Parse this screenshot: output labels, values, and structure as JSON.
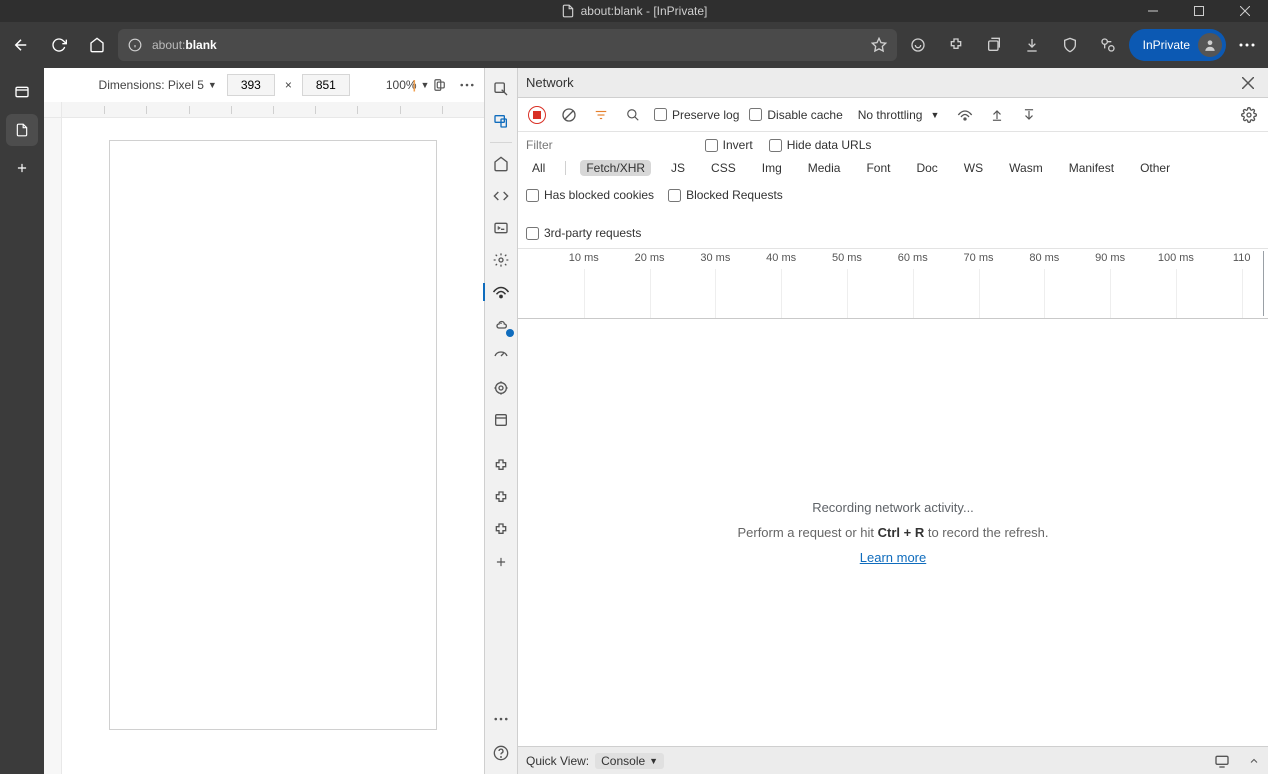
{
  "titlebar": {
    "title": "about:blank - [InPrivate]"
  },
  "toolbar": {
    "url_protocol": "about:",
    "url_rest": "blank",
    "inprivate_label": "InPrivate"
  },
  "device_bar": {
    "dimensions_label": "Dimensions: Pixel 5",
    "width": "393",
    "height": "851",
    "x_label": "×",
    "zoom": "100%"
  },
  "devtools": {
    "panel_title": "Network",
    "preserve_log": "Preserve log",
    "disable_cache": "Disable cache",
    "throttling": "No throttling",
    "filter_label": "Filter",
    "invert_label": "Invert",
    "hide_data_urls": "Hide data URLs",
    "filter_all": "All",
    "filter_fetch": "Fetch/XHR",
    "filter_js": "JS",
    "filter_css": "CSS",
    "filter_img": "Img",
    "filter_media": "Media",
    "filter_font": "Font",
    "filter_doc": "Doc",
    "filter_ws": "WS",
    "filter_wasm": "Wasm",
    "filter_manifest": "Manifest",
    "filter_other": "Other",
    "blocked_cookies": "Has blocked cookies",
    "blocked_requests": "Blocked Requests",
    "third_party": "3rd-party requests",
    "timeline_ticks": [
      "10 ms",
      "20 ms",
      "30 ms",
      "40 ms",
      "50 ms",
      "60 ms",
      "70 ms",
      "80 ms",
      "90 ms",
      "100 ms",
      "110"
    ],
    "recording_msg": "Recording network activity...",
    "hint_prefix": "Perform a request or hit ",
    "hint_key": "Ctrl + R",
    "hint_suffix": " to record the refresh.",
    "learn_more": "Learn more",
    "quick_view_label": "Quick View:",
    "quick_view_value": "Console"
  }
}
